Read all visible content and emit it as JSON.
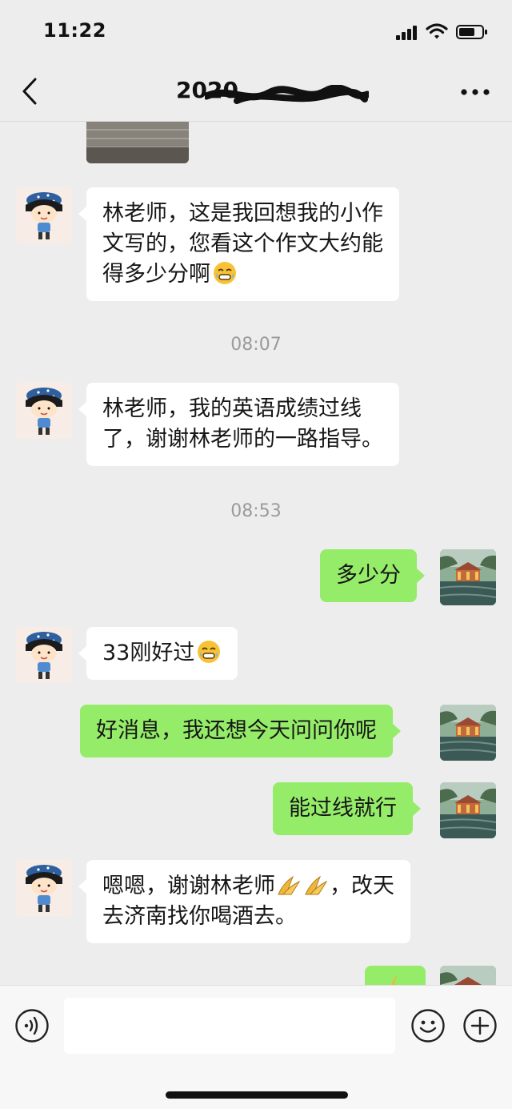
{
  "status_bar": {
    "time": "11:22"
  },
  "nav": {
    "title": "2020",
    "back_icon": "chevron-left-icon",
    "more_icon": "more-dots-icon"
  },
  "messages": [
    {
      "sender": "contact",
      "text_parts": [
        "林老师，这是我回想我的小作",
        "文写的，您看这个作文大约能",
        "得多少分啊"
      ],
      "emoji": "grimace-sweat-emoji"
    },
    {
      "type": "timestamp",
      "text": "08:07"
    },
    {
      "sender": "contact",
      "text_parts": [
        "林老师，我的英语成绩过线",
        "了，谢谢林老师的一路指导。"
      ]
    },
    {
      "type": "timestamp",
      "text": "08:53"
    },
    {
      "sender": "me",
      "text": "多少分"
    },
    {
      "sender": "contact",
      "text": "33刚好过",
      "emoji": "grimace-sweat-emoji"
    },
    {
      "sender": "me",
      "text": "好消息，我还想今天问问你呢"
    },
    {
      "sender": "me",
      "text": "能过线就行"
    },
    {
      "sender": "contact",
      "text_parts": [
        "嗯嗯，谢谢林老师",
        "，改天",
        "去济南找你喝酒去。"
      ],
      "emoji": "praying-hands-emoji"
    }
  ],
  "input_bar": {
    "voice_icon": "voice-icon",
    "emoji_icon": "smiley-icon",
    "plus_icon": "plus-icon",
    "placeholder": ""
  },
  "colors": {
    "background": "#ededed",
    "outgoing_bubble": "#95ec69",
    "incoming_bubble": "#ffffff",
    "timestamp_text": "#9b9b9b"
  }
}
